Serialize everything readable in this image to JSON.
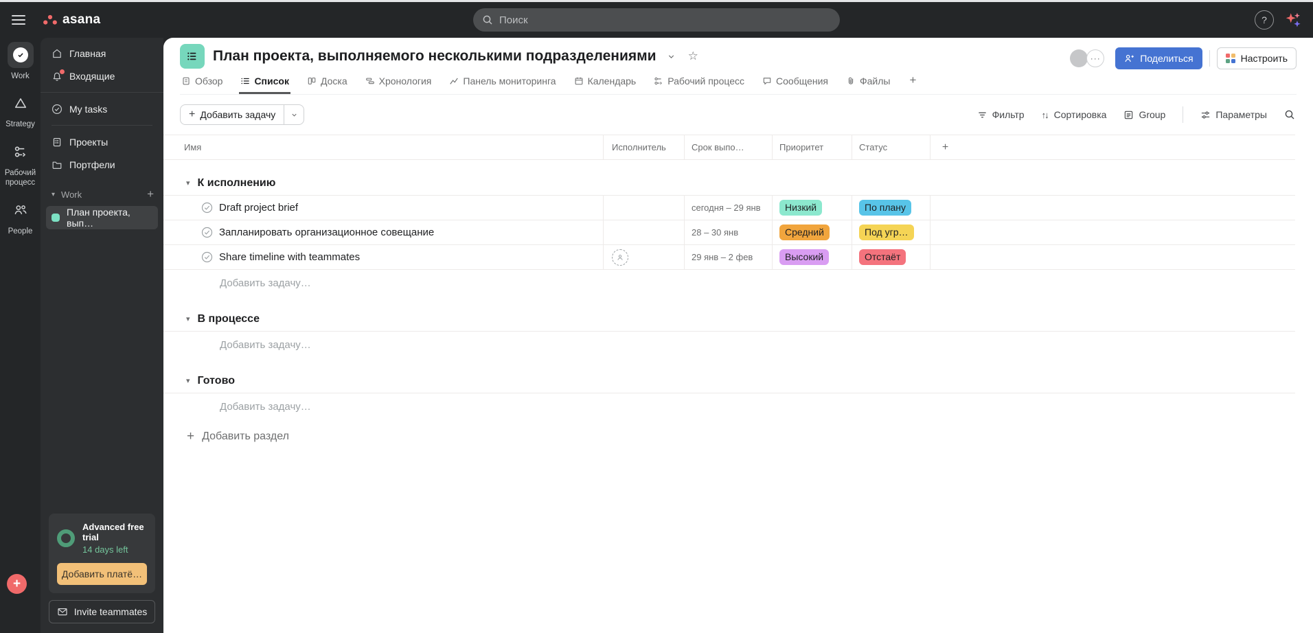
{
  "brand": "asana",
  "topbar": {
    "search_placeholder": "Поиск"
  },
  "rail": {
    "items": [
      {
        "label": "Work"
      },
      {
        "label": "Strategy"
      },
      {
        "label": "Рабочий процесс"
      },
      {
        "label": "People"
      }
    ]
  },
  "sidebar": {
    "nav": [
      {
        "label": "Главная"
      },
      {
        "label": "Входящие"
      }
    ],
    "tasks_item": {
      "label": "My tasks"
    },
    "browse": [
      {
        "label": "Проекты"
      },
      {
        "label": "Портфели"
      }
    ],
    "team_section": {
      "label": "Work"
    },
    "project": {
      "label": "План проекта, вып…",
      "swatch_color": "#7ce0c3"
    },
    "trial": {
      "title": "Advanced free trial",
      "days_left": "14 days left",
      "billing_button": "Добавить платё…",
      "ring_color": "#4f9c78",
      "button_bg": "#f2c078"
    },
    "invite_button": "Invite teammates"
  },
  "header": {
    "title": "План проекта, выполняемого несколькими подразделениями",
    "project_icon_bg": "#76d7bc",
    "share_button": "Поделиться",
    "share_button_bg": "#4573d2",
    "customize_button": "Настроить",
    "tabs": [
      {
        "label": "Обзор"
      },
      {
        "label": "Список"
      },
      {
        "label": "Доска"
      },
      {
        "label": "Хронология"
      },
      {
        "label": "Панель мониторинга"
      },
      {
        "label": "Календарь"
      },
      {
        "label": "Рабочий процесс"
      },
      {
        "label": "Сообщения"
      },
      {
        "label": "Файлы"
      }
    ],
    "active_tab": "Список"
  },
  "toolbar": {
    "add_task": "Добавить задачу",
    "filter": "Фильтр",
    "sort": "Сортировка",
    "group": "Group",
    "options": "Параметры"
  },
  "table": {
    "columns": [
      "Имя",
      "Исполнитель",
      "Срок выпо…",
      "Приоритет",
      "Статус"
    ],
    "add_task_placeholder": "Добавить задачу…",
    "add_section": "Добавить раздел",
    "sections": [
      {
        "title": "К исполнению",
        "tasks": [
          {
            "name": "Draft project brief",
            "due": "сегодня – 29 янв",
            "priority": "Низкий",
            "priority_color": "#8ce8ce",
            "status": "По плану",
            "status_color": "#58c4e8"
          },
          {
            "name": "Запланировать организационное совещание",
            "due": "28 – 30 янв",
            "priority": "Средний",
            "priority_color": "#f1a53d",
            "status": "Под угр…",
            "status_color": "#f5d455"
          },
          {
            "name": "Share timeline with teammates",
            "due": "29 янв – 2 фев",
            "priority": "Высокий",
            "priority_color": "#d99df2",
            "status": "Отстаёт",
            "status_color": "#f4737d"
          }
        ]
      },
      {
        "title": "В процессе",
        "tasks": []
      },
      {
        "title": "Готово",
        "tasks": []
      }
    ]
  },
  "icons": {
    "plus": "+",
    "caret": "▾",
    "star": "☆",
    "sort": "↑↓",
    "dots": "···",
    "question": "?"
  },
  "colors": {
    "accent_coral": "#f06a6a",
    "dark_bg": "#242628",
    "sidebar_bg": "#2c2e30",
    "border_light": "#edeae9",
    "text_gray": "#6d6e6f"
  }
}
